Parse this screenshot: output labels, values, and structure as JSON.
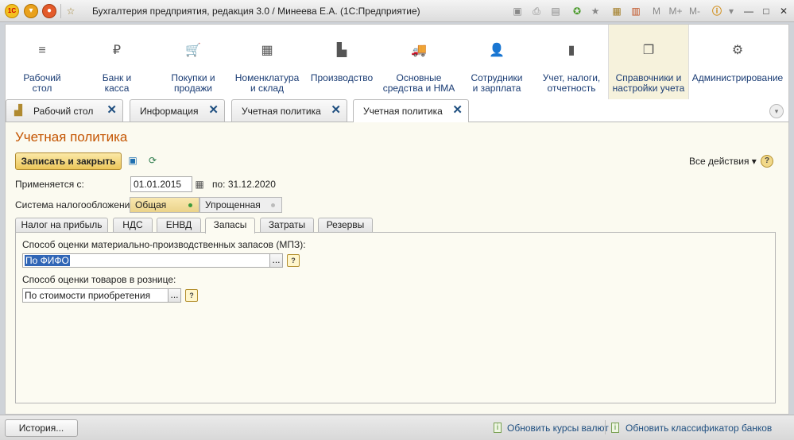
{
  "window": {
    "title": "Бухгалтерия предприятия, редакция 3.0 / Минеева Е.А.  (1С:Предприятие)",
    "logo_text": "1С"
  },
  "titlebar_icons": [
    "menu-icon",
    "home-icon",
    "favorites-star-icon",
    "save-icon",
    "print-icon",
    "print-preview-icon",
    "add-favorite-icon",
    "history-icon",
    "calculator-icon",
    "calendar-icon"
  ],
  "memory_buttons": [
    "M",
    "M+",
    "M-"
  ],
  "sections": [
    {
      "label": "Рабочий стол",
      "icon": "≡"
    },
    {
      "label": "Банк и касса",
      "icon": "₽"
    },
    {
      "label": "Покупки и продажи",
      "icon": "🛒"
    },
    {
      "label": "Номенклатура и склад",
      "icon": "▦"
    },
    {
      "label": "Производство",
      "icon": "▙"
    },
    {
      "label": "Основные средства и НМА",
      "icon": "🚚"
    },
    {
      "label": "Сотрудники и зарплата",
      "icon": "👤"
    },
    {
      "label": "Учет, налоги, отчетность",
      "icon": "▮"
    },
    {
      "label": "Справочники и настройки учета",
      "icon": "❐"
    },
    {
      "label": "Администрирование",
      "icon": "⚙"
    }
  ],
  "open_tabs": [
    {
      "label": "Рабочий стол"
    },
    {
      "label": "Информация"
    },
    {
      "label": "Учетная политика"
    },
    {
      "label": "Учетная политика"
    }
  ],
  "form": {
    "title": "Учетная политика",
    "save_close": "Записать и закрыть",
    "all_actions": "Все действия ▾",
    "help": "?",
    "applies_label": "Применяется с:",
    "applies_from": "01.01.2015",
    "applies_to": "по: 31.12.2020",
    "tax_label": "Система налогообложения:",
    "tax_options": [
      "Общая",
      "Упрощенная"
    ],
    "inner_tabs": [
      "Налог на прибыль",
      "НДС",
      "ЕНВД",
      "Запасы",
      "Затраты",
      "Резервы"
    ],
    "mpz_label": "Способ оценки материально-производственных запасов (МПЗ):",
    "mpz_value": "По ФИФО",
    "retail_label": "Способ оценки товаров в рознице:",
    "retail_value": "По стоимости приобретения",
    "dots": "..."
  },
  "status": {
    "history": "История...",
    "link_rates": "Обновить курсы валют",
    "link_banks": "Обновить классификатор банков"
  }
}
